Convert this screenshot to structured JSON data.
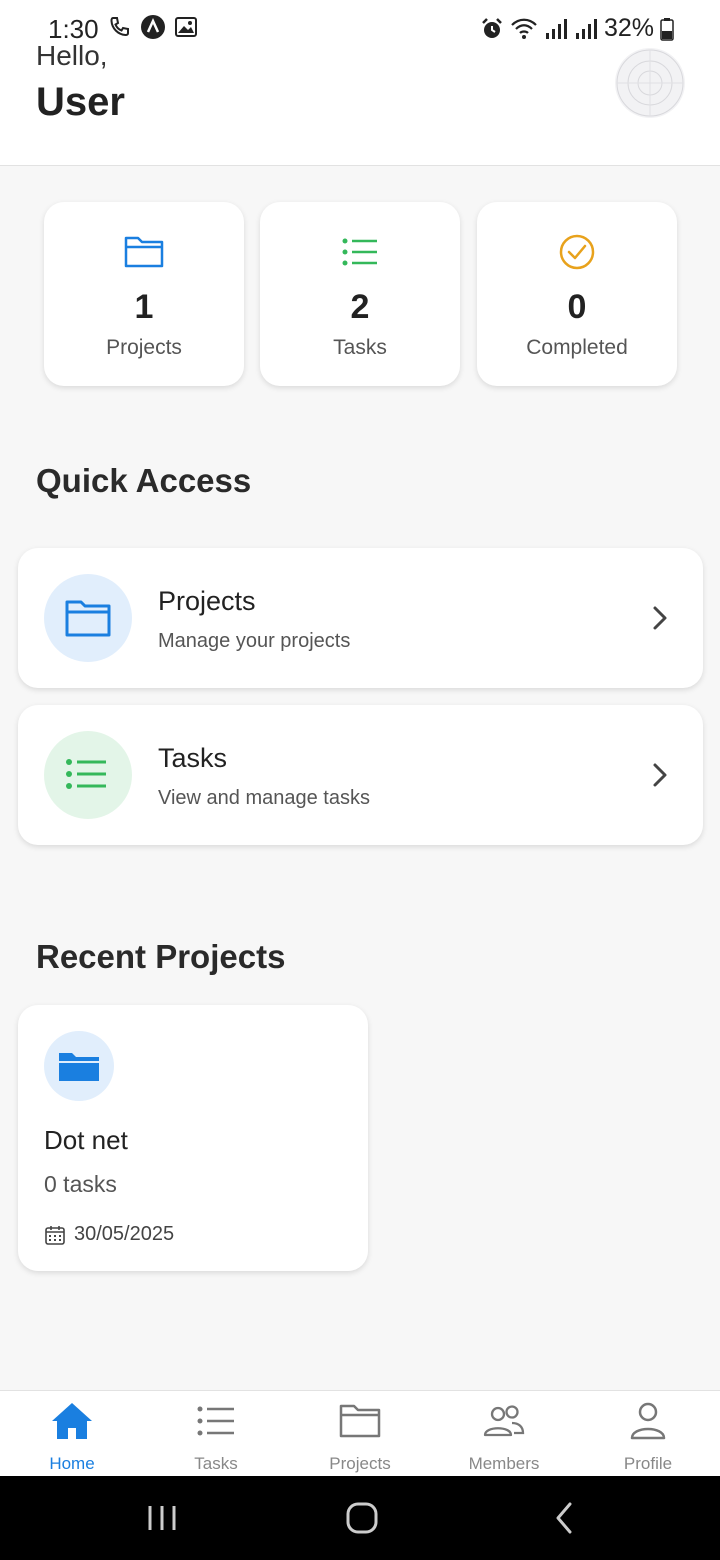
{
  "status_bar": {
    "time": "1:30",
    "battery": "32%",
    "left_icons": [
      "phone-icon",
      "app-a-icon",
      "image-icon"
    ],
    "right_icons": [
      "alarm-icon",
      "wifi-icon",
      "signal-icon",
      "signal-icon",
      "battery-icon"
    ]
  },
  "header": {
    "greeting": "Hello,",
    "username": "User"
  },
  "stats": [
    {
      "icon": "folder-icon",
      "value": "1",
      "label": "Projects",
      "color": "#1a7fe0"
    },
    {
      "icon": "list-icon",
      "value": "2",
      "label": "Tasks",
      "color": "#34b85a"
    },
    {
      "icon": "check-circle-icon",
      "value": "0",
      "label": "Completed",
      "color": "#e8a21c"
    }
  ],
  "quick_access": {
    "title": "Quick Access",
    "items": [
      {
        "icon": "folder-icon",
        "title": "Projects",
        "subtitle": "Manage your projects",
        "bg": "#e1eefc",
        "color": "#1a7fe0"
      },
      {
        "icon": "list-icon",
        "title": "Tasks",
        "subtitle": "View and manage tasks",
        "bg": "#e3f5e8",
        "color": "#34b85a"
      }
    ]
  },
  "recent_projects": {
    "title": "Recent Projects",
    "items": [
      {
        "icon": "folder-filled-icon",
        "name": "Dot net",
        "tasks": "0 tasks",
        "date": "30/05/2025"
      }
    ]
  },
  "bottom_nav": {
    "items": [
      {
        "label": "Home",
        "icon": "home-icon",
        "active": true
      },
      {
        "label": "Tasks",
        "icon": "list-icon",
        "active": false
      },
      {
        "label": "Projects",
        "icon": "folder-icon",
        "active": false
      },
      {
        "label": "Members",
        "icon": "members-icon",
        "active": false
      },
      {
        "label": "Profile",
        "icon": "person-icon",
        "active": false
      }
    ]
  },
  "colors": {
    "accent": "#1a7fe0",
    "green": "#34b85a",
    "orange": "#e8a21c"
  }
}
